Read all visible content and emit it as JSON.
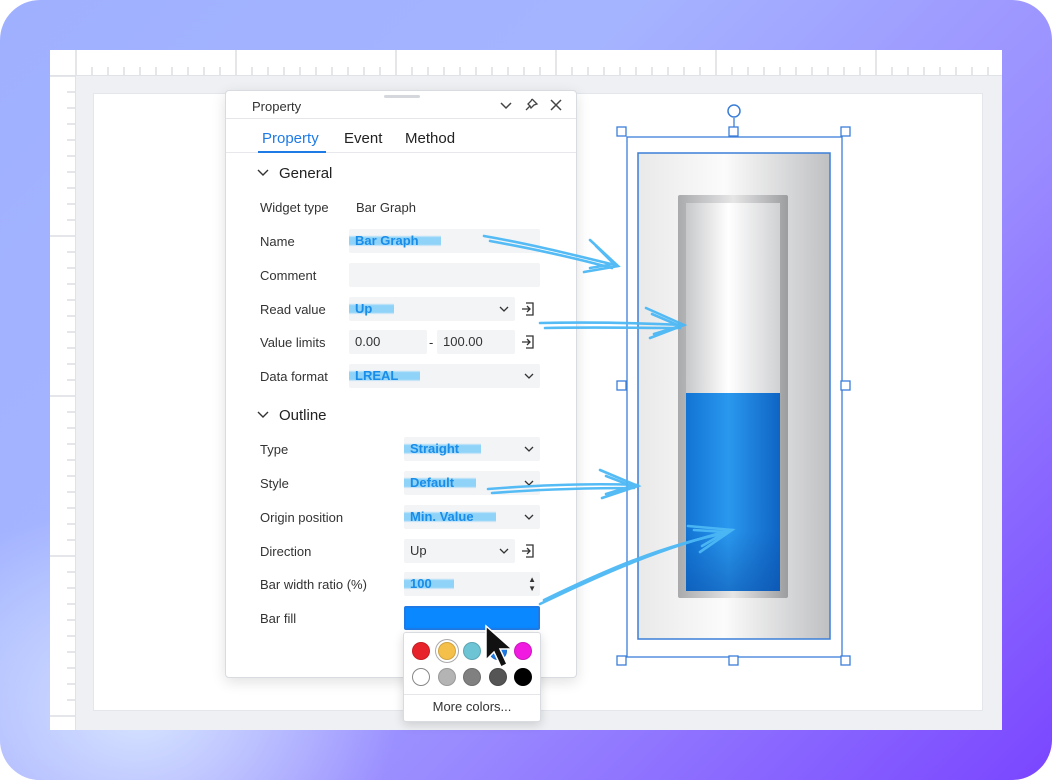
{
  "panel": {
    "title": "Property",
    "tabs": [
      {
        "label": "Property",
        "active": true
      },
      {
        "label": "Event",
        "active": false
      },
      {
        "label": "Method",
        "active": false
      }
    ]
  },
  "general": {
    "title": "General",
    "widget_type_label": "Widget type",
    "widget_type_value": "Bar Graph",
    "name_label": "Name",
    "name_value": "Bar Graph",
    "comment_label": "Comment",
    "comment_value": "",
    "read_value_label": "Read value",
    "read_value_value": "Up",
    "value_limits_label": "Value limits",
    "value_limits_min": "0.00",
    "value_limits_sep": "-",
    "value_limits_max": "100.00",
    "data_format_label": "Data format",
    "data_format_value": "LREAL"
  },
  "outline": {
    "title": "Outline",
    "type_label": "Type",
    "type_value": "Straight",
    "style_label": "Style",
    "style_value": "Default",
    "origin_label": "Origin position",
    "origin_value": "Min. Value",
    "direction_label": "Direction",
    "direction_value": "Up",
    "bar_width_label": "Bar width ratio (%)",
    "bar_width_value": "100",
    "bar_fill_label": "Bar fill",
    "bar_fill_color": "#0a88ff"
  },
  "palette": {
    "colors_row1": [
      "#e8222a",
      "#f5c04a",
      "#6cc4d4",
      "#1e7be6",
      "#f01ae0"
    ],
    "colors_row2": [
      "#ffffff",
      "#b4b4b4",
      "#808080",
      "#555555",
      "#000000"
    ],
    "more_label": "More colors..."
  },
  "bar_graph": {
    "fill_fraction": 0.51,
    "fill_color": "#1a8ce8"
  },
  "colors": {
    "accent": "#1e7be6",
    "highlight": "#6ec8fa"
  }
}
